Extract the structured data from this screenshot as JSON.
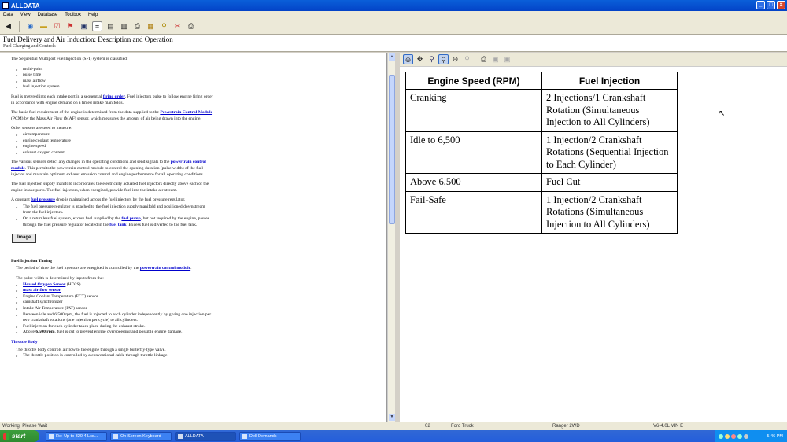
{
  "window": {
    "title": "ALLDATA",
    "buttons": [
      "_",
      "□",
      "×"
    ]
  },
  "menu": [
    "Data",
    "View",
    "Database",
    "Toolbox",
    "Help"
  ],
  "toolbar": {
    "icons": [
      "back-arrow-icon",
      "globe-icon",
      "folder-icon",
      "checklist-icon",
      "flag-icon",
      "car-icon",
      "document-icon",
      "bookmark-icon",
      "print-preview-icon",
      "printer-icon",
      "save-icon",
      "pin-icon",
      "tools-icon",
      "print-icon"
    ]
  },
  "header": {
    "title": "Fuel Delivery and Air Induction:  Description and Operation",
    "subtitle": "Fuel Charging and Controls"
  },
  "article": {
    "p1": "The Sequential Multiport Fuel Injection (SFI) system is classified:",
    "list1": [
      "multi-point",
      "pulse time",
      "mass airflow",
      "fuel injection system"
    ],
    "p2a": "Fuel is metered into each intake port in a sequential ",
    "p2link": "firing order",
    "p2b": ". Fuel injectors pulse to follow engine firing order in accordance with engine demand on a timed intake manifolds.",
    "p3a": "The basic fuel requirement of the engine is determined from the data supplied to the ",
    "p3link": "Powertrain Control Module",
    "p3b": " (PCM) by the Mass Air Flow (MAF) sensor, which measures the amount of air being drawn into the engine.",
    "p4": "Other sensors are used to measure:",
    "list2": [
      "air temperature",
      "engine coolant temperature",
      "engine speed",
      "exhaust oxygen content"
    ],
    "p5a": "The various sensors detect any changes in the operating conditions and send signals to the ",
    "p5link": "powertrain control module",
    "p5b": ". This permits the powertrain control module to control the opening duration (pulse width) of the fuel injector and maintain optimum exhaust emission control and engine performance for all operating conditions.",
    "p6": "The fuel injection supply manifold incorporates the electrically actuated fuel injectors directly above each of the engine intake ports. The fuel injectors, when energized, provide fuel into the intake air stream.",
    "p7a": "A constant ",
    "p7link": "fuel pressure",
    "p7b": " drop is maintained across the fuel injectors by the fuel pressure regulator.",
    "list3_1": "The fuel pressure regulator is attached to the fuel injection supply manifold and positioned downstream from the fuel injectors.",
    "list3_2a": "On a returnless fuel system, excess fuel supplied by the ",
    "list3_2link1": "fuel pump",
    "list3_2b": ", but not required by the engine, passes through the fuel pressure regulator located in the ",
    "list3_2link2": "fuel tank",
    "list3_2c": ". Excess fuel is diverted to the fuel tank.",
    "image_button": "Image",
    "h2": "Fuel Injection Timing",
    "p8a": "The period of time the fuel injectors are energized is controlled by the ",
    "p8link": "powertrain control module",
    "p8b": ".",
    "p9": "The pulse width is determined by inputs from the:",
    "list4_link1": "Heated Oxygen Sensor",
    "list4_1b": " (HO2S)",
    "list4_link2": "mass air flow sensor",
    "list4_3": "Engine Coolant Temperature (ECT) sensor",
    "list4_4": "camshaft synchronizer",
    "list4_5": "Intake Air Temperature (IAT) sensor",
    "list4_6": "Between idle and 6,500 rpm, the fuel is injected to each cylinder independently by giving one injection per two crankshaft rotations (one injection per cycle) to all cylinders.",
    "list4_7": "Fuel injection for each cylinder takes place during the exhaust stroke.",
    "list4_8a": "Above ",
    "list4_8bold": "6,500 rpm",
    "list4_8b": ", fuel is cut to prevent engine overspeeding and possible engine damage.",
    "h3": "Throttle Body",
    "p10": "The throttle body controls airflow to the engine through a single butterfly-type valve.",
    "list5_1": "The throttle position is controlled by a conventional cable through throttle linkage."
  },
  "right_toolbar": {
    "icons": [
      "zoom-in-icon",
      "pan-icon",
      "zoom-area-icon",
      "zoom-fit-icon",
      "zoom-out-icon",
      "zoom-disabled-icon",
      "print-icon",
      "copy-icon",
      "image-icon"
    ]
  },
  "table": {
    "headers": [
      "Engine Speed (RPM)",
      "Fuel Injection"
    ],
    "rows": [
      {
        "speed": "Cranking",
        "injection": "2 Injections/1 Crankshaft Rotation (Simultaneous Injection to All Cylinders)"
      },
      {
        "speed": "Idle to 6,500",
        "injection": "1 Injection/2 Crankshaft Rotations (Sequential Injection to Each Cylinder)"
      },
      {
        "speed": "Above 6,500",
        "injection": "Fuel Cut"
      },
      {
        "speed": "Fail-Safe",
        "injection": "1 Injection/2 Crankshaft Rotations (Simultaneous Injection to All Cylinders)"
      }
    ]
  },
  "status": {
    "left": "Working, Please Wait",
    "s2": "02",
    "s3": "Ford Truck",
    "s4": "Ranger 2WD",
    "s5": "V6-4.0L VIN E"
  },
  "taskbar": {
    "start": "start",
    "tasks": [
      "Re: Up to 320 4 Lcs...",
      "On-Screen Keyboard",
      "ALLDATA",
      "Dell Demands"
    ],
    "clock": "5:46 PM"
  }
}
